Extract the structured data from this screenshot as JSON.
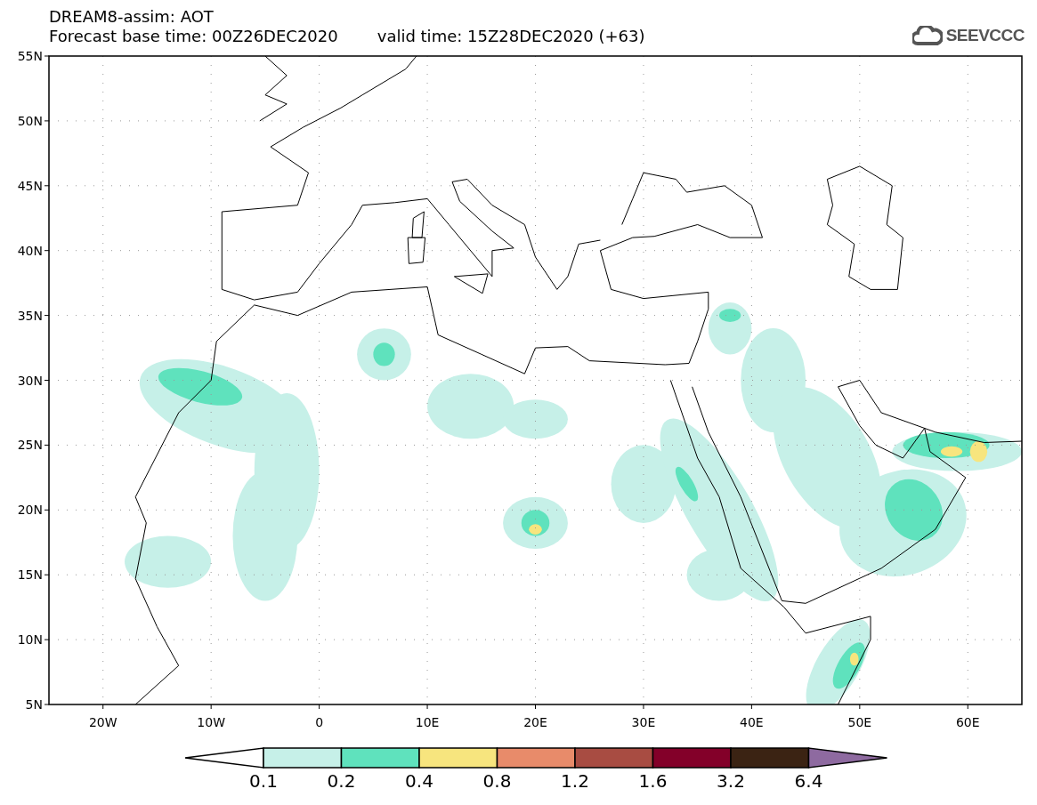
{
  "header": {
    "title": "DREAM8-assim: AOT",
    "base_time": "Forecast base time: 00Z26DEC2020",
    "valid_time": "valid time: 15Z28DEC2020 (+63)",
    "logo_text": "SEEVCCC"
  },
  "map": {
    "y_labels": [
      "55N",
      "50N",
      "45N",
      "40N",
      "35N",
      "30N",
      "25N",
      "20N",
      "15N",
      "10N",
      "5N"
    ],
    "x_labels": [
      "20W",
      "10W",
      "0",
      "10E",
      "20E",
      "30E",
      "40E",
      "50E",
      "60E"
    ]
  },
  "legend": {
    "under_arrow": {
      "color": "#ffffff"
    },
    "over_arrow": {
      "color": "#8e6aa0"
    },
    "segments": [
      {
        "color": "#c6f0e8"
      },
      {
        "color": "#5fe2bd"
      },
      {
        "color": "#f7e57e"
      },
      {
        "color": "#e88b6a"
      },
      {
        "color": "#a84c42"
      },
      {
        "color": "#830029"
      },
      {
        "color": "#3b2313"
      }
    ],
    "labels": [
      "0.1",
      "0.2",
      "0.4",
      "0.8",
      "1.2",
      "1.6",
      "3.2",
      "6.4"
    ]
  }
}
